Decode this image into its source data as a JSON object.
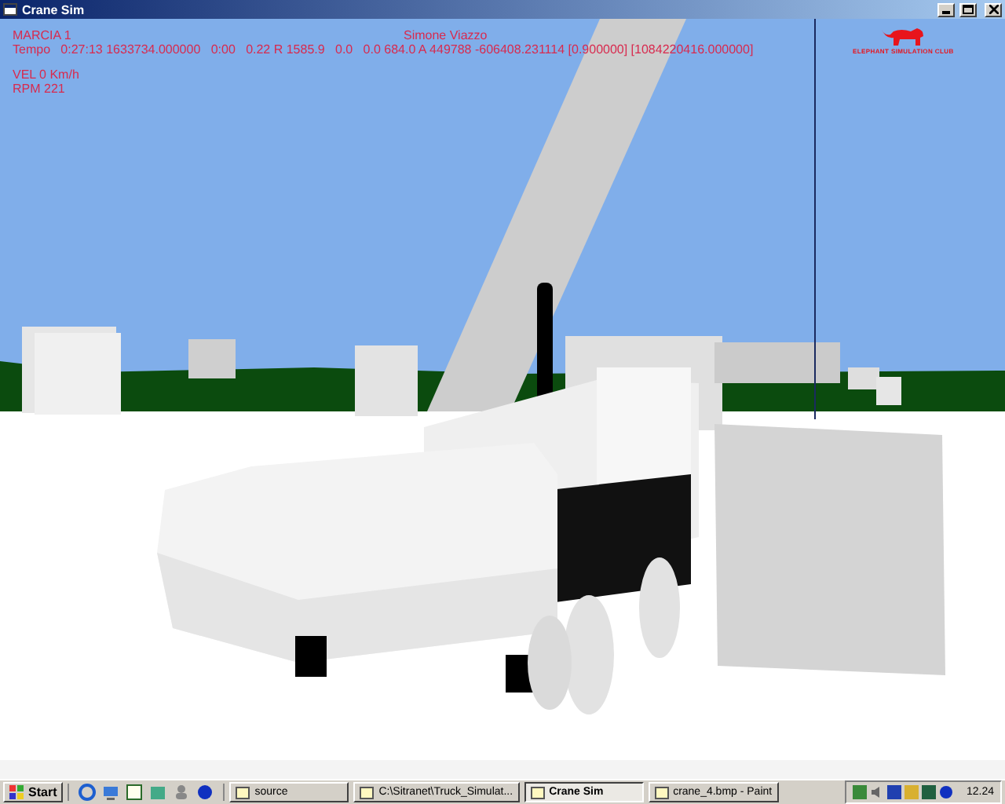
{
  "window": {
    "title": "Crane Sim"
  },
  "hud": {
    "gear": "MARCIA 1",
    "driver": "Simone Viazzo",
    "telemetry": "Tempo   0:27:13 1633734.000000   0:00   0.22 R 1585.9   0.0   0.0 684.0 A 449788 -606408.231114 [0.900000] [1084220416.000000]",
    "speed": "VEL 0 Km/h",
    "rpm": "RPM 221"
  },
  "logo": {
    "text": "ELEPHANT SIMULATION CLUB"
  },
  "taskbar": {
    "start": "Start",
    "tasks": [
      {
        "label": "source",
        "selected": false
      },
      {
        "label": "C:\\Sitranet\\Truck_Simulat...",
        "selected": false
      },
      {
        "label": "Crane Sim",
        "selected": true
      },
      {
        "label": "crane_4.bmp - Paint",
        "selected": false
      }
    ],
    "clock": "12.24"
  }
}
